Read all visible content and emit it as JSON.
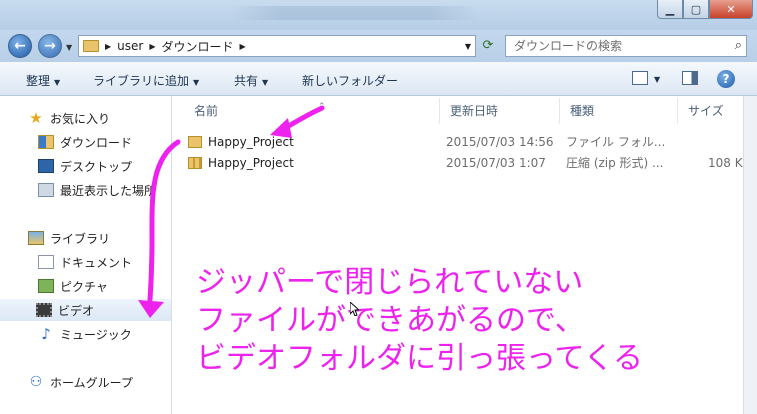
{
  "address": {
    "crumbs": [
      "user",
      "ダウンロード"
    ],
    "search_placeholder": "ダウンロードの検索"
  },
  "toolbar": {
    "organize": "整理",
    "add_library": "ライブラリに追加",
    "share": "共有",
    "new_folder": "新しいフォルダー"
  },
  "nav": {
    "favorites": "お気に入り",
    "downloads": "ダウンロード",
    "desktop": "デスクトップ",
    "recent": "最近表示した場所",
    "libraries": "ライブラリ",
    "documents": "ドキュメント",
    "pictures": "ピクチャ",
    "videos": "ビデオ",
    "music": "ミュージック",
    "homegroup": "ホームグループ"
  },
  "columns": {
    "name": "名前",
    "modified": "更新日時",
    "type": "種類",
    "size": "サイズ"
  },
  "files": [
    {
      "name": "Happy_Project",
      "modified": "2015/07/03 14:56",
      "type": "ファイル フォル...",
      "size": "",
      "icon": "folder-icon"
    },
    {
      "name": "Happy_Project",
      "modified": "2015/07/03 1:07",
      "type": "圧縮 (zip 形式) ...",
      "size": "108 KB",
      "icon": "zip-folder-icon"
    }
  ],
  "annotation": {
    "lines": [
      "ジッパーで閉じられていない",
      "ファイルができあがるので、",
      "ビデオフォルダに引っ張ってくる"
    ],
    "color": "#ee22ee"
  }
}
